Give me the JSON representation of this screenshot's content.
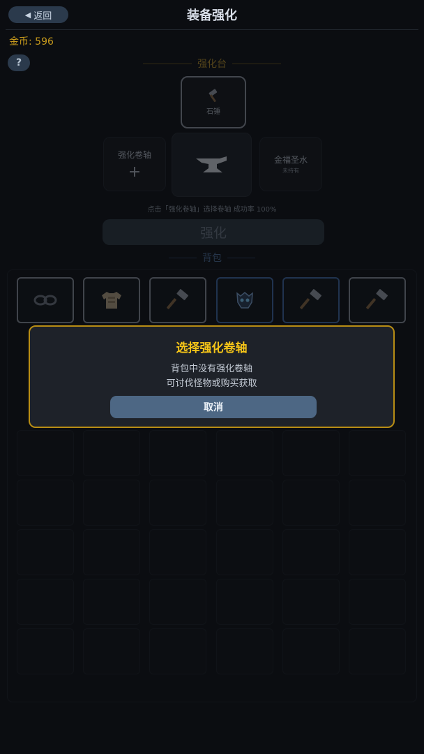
{
  "header": {
    "back_label": "返回",
    "title": "装备强化"
  },
  "gold_text": "金币: 596",
  "help_label": "?",
  "forge": {
    "section_title": "强化台",
    "tool_slot_label": "石锤",
    "scroll_slot_label": "强化卷轴",
    "scroll_slot_plus": "+",
    "water_slot_label": "金福圣水",
    "water_slot_sub": "未持有",
    "hint": "点击「强化卷轴」选择卷轴  成功率 100%",
    "enhance_button_label": "强化"
  },
  "bag": {
    "section_title": "背包",
    "items": [
      {
        "icon": "goggles-icon",
        "highlight": "gray"
      },
      {
        "icon": "armor-icon",
        "highlight": "gray"
      },
      {
        "icon": "hammer-icon",
        "highlight": "gray"
      },
      {
        "icon": "helmet-icon",
        "highlight": "blue"
      },
      {
        "icon": "hammer-icon",
        "highlight": "blue"
      },
      {
        "icon": "hammer-icon",
        "highlight": "gray"
      }
    ]
  },
  "modal": {
    "title": "选择强化卷轴",
    "message_line1": "背包中没有强化卷轴",
    "message_line2": "可讨伐怪物或购买获取",
    "cancel_label": "取消"
  },
  "colors": {
    "accent_gold": "#f5c518",
    "gold_text": "#c79a1c",
    "button_blue": "#4d6784",
    "rarity_blue": "#3f6aa6"
  }
}
